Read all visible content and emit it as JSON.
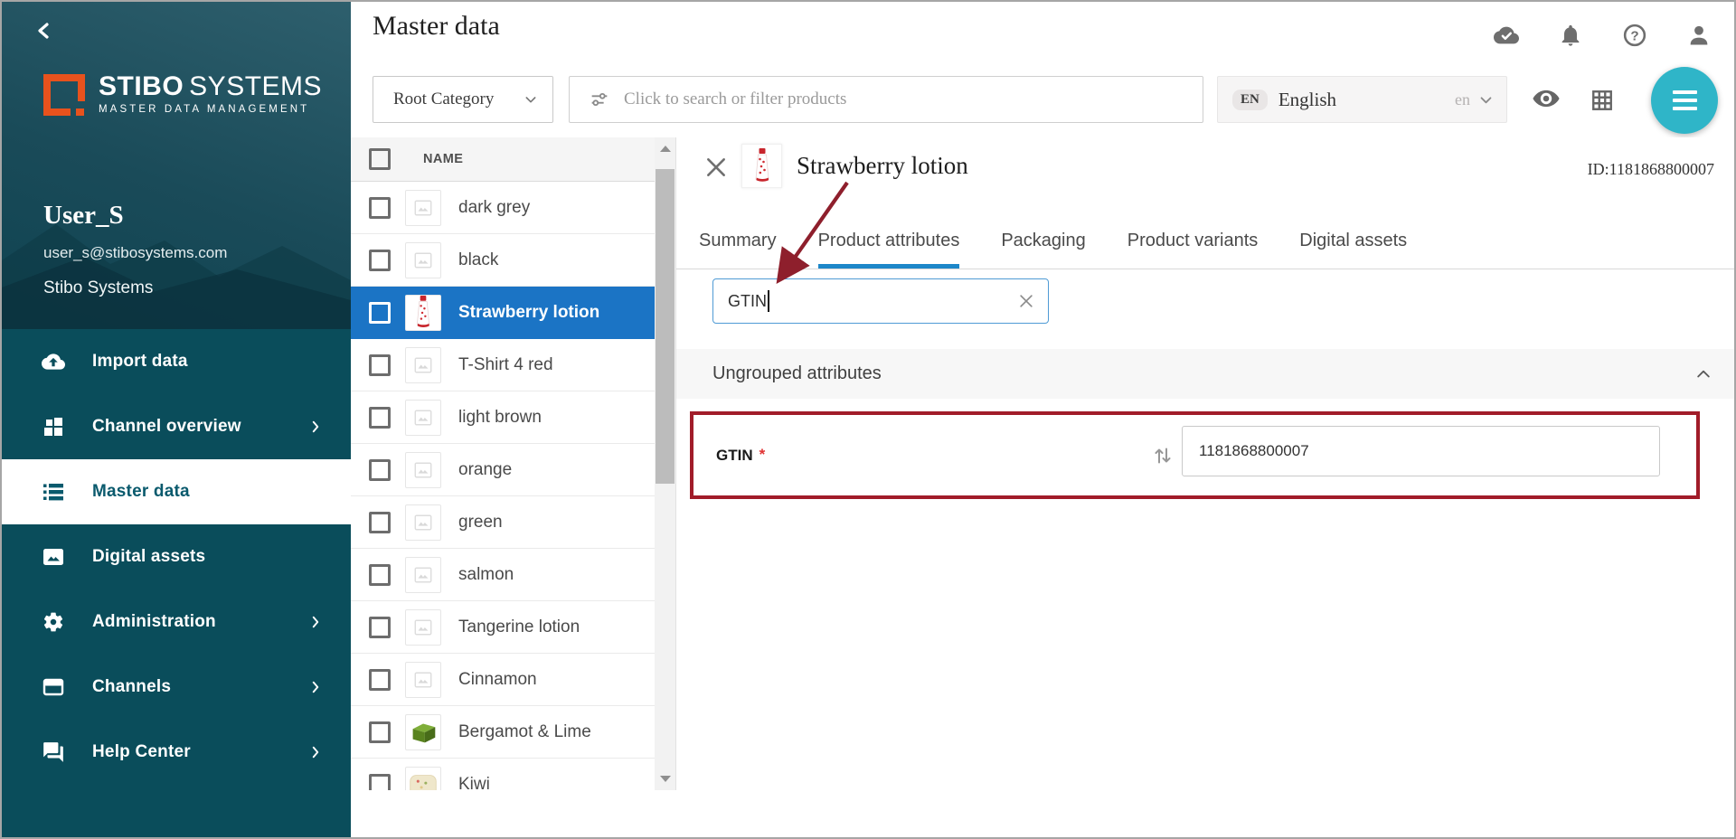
{
  "colors": {
    "sidebar_teal": "#0a4d5b",
    "selected_row_blue": "#1b74c5",
    "fab_teal": "#2fb5c8",
    "tab_underline_blue": "#1d87c9",
    "annotation_red": "#9d1f2c",
    "logo_orange": "#e8521d",
    "attr_search_border_blue": "#4f9bd5"
  },
  "sidebar": {
    "logo": {
      "brand_bold": "STIBO",
      "brand_light": "SYSTEMS",
      "tagline": "MASTER DATA MANAGEMENT"
    },
    "user": {
      "name": "User_S",
      "email": "user_s@stibosystems.com",
      "organization": "Stibo Systems"
    },
    "items": [
      {
        "label": "Import data",
        "icon": "cloud-upload-icon",
        "selected": false,
        "has_submenu": false
      },
      {
        "label": "Channel overview",
        "icon": "dashboard-icon",
        "selected": false,
        "has_submenu": true
      },
      {
        "label": "Master data",
        "icon": "list-icon",
        "selected": true,
        "has_submenu": false
      },
      {
        "label": "Digital assets",
        "icon": "image-icon",
        "selected": false,
        "has_submenu": false
      },
      {
        "label": "Administration",
        "icon": "gear-icon",
        "selected": false,
        "has_submenu": true
      },
      {
        "label": "Channels",
        "icon": "card-icon",
        "selected": false,
        "has_submenu": true
      },
      {
        "label": "Help Center",
        "icon": "chat-icon",
        "selected": false,
        "has_submenu": true
      }
    ]
  },
  "header": {
    "title": "Master data",
    "category_dropdown": {
      "value": "Root Category"
    },
    "search": {
      "placeholder": "Click to search or filter products"
    },
    "language": {
      "badge": "EN",
      "label": "English",
      "code": "en"
    }
  },
  "product_list": {
    "name_header": "NAME",
    "items": [
      {
        "name": "dark grey",
        "thumb": "placeholder",
        "selected": false
      },
      {
        "name": "black",
        "thumb": "placeholder",
        "selected": false
      },
      {
        "name": "Strawberry lotion",
        "thumb": "strawberry-tube",
        "selected": true
      },
      {
        "name": "T-Shirt 4 red",
        "thumb": "placeholder",
        "selected": false
      },
      {
        "name": "light brown",
        "thumb": "placeholder",
        "selected": false
      },
      {
        "name": "orange",
        "thumb": "placeholder",
        "selected": false
      },
      {
        "name": "green",
        "thumb": "placeholder",
        "selected": false
      },
      {
        "name": "salmon",
        "thumb": "placeholder",
        "selected": false
      },
      {
        "name": "Tangerine lotion",
        "thumb": "placeholder",
        "selected": false
      },
      {
        "name": "Cinnamon",
        "thumb": "placeholder",
        "selected": false
      },
      {
        "name": "Bergamot & Lime",
        "thumb": "green-soap",
        "selected": false
      },
      {
        "name": "Kiwi",
        "thumb": "kiwi-soap",
        "selected": false
      }
    ]
  },
  "detail": {
    "title": "Strawberry lotion",
    "id_label": "ID:1181868800007",
    "tabs": [
      {
        "label": "Summary",
        "active": false
      },
      {
        "label": "Product attributes",
        "active": true
      },
      {
        "label": "Packaging",
        "active": false
      },
      {
        "label": "Product variants",
        "active": false
      },
      {
        "label": "Digital assets",
        "active": false
      }
    ],
    "attribute_search": {
      "value": "GTIN"
    },
    "section": {
      "title": "Ungrouped attributes"
    },
    "attribute_row": {
      "label": "GTIN",
      "required_marker": "*",
      "value": "1181868800007"
    }
  }
}
